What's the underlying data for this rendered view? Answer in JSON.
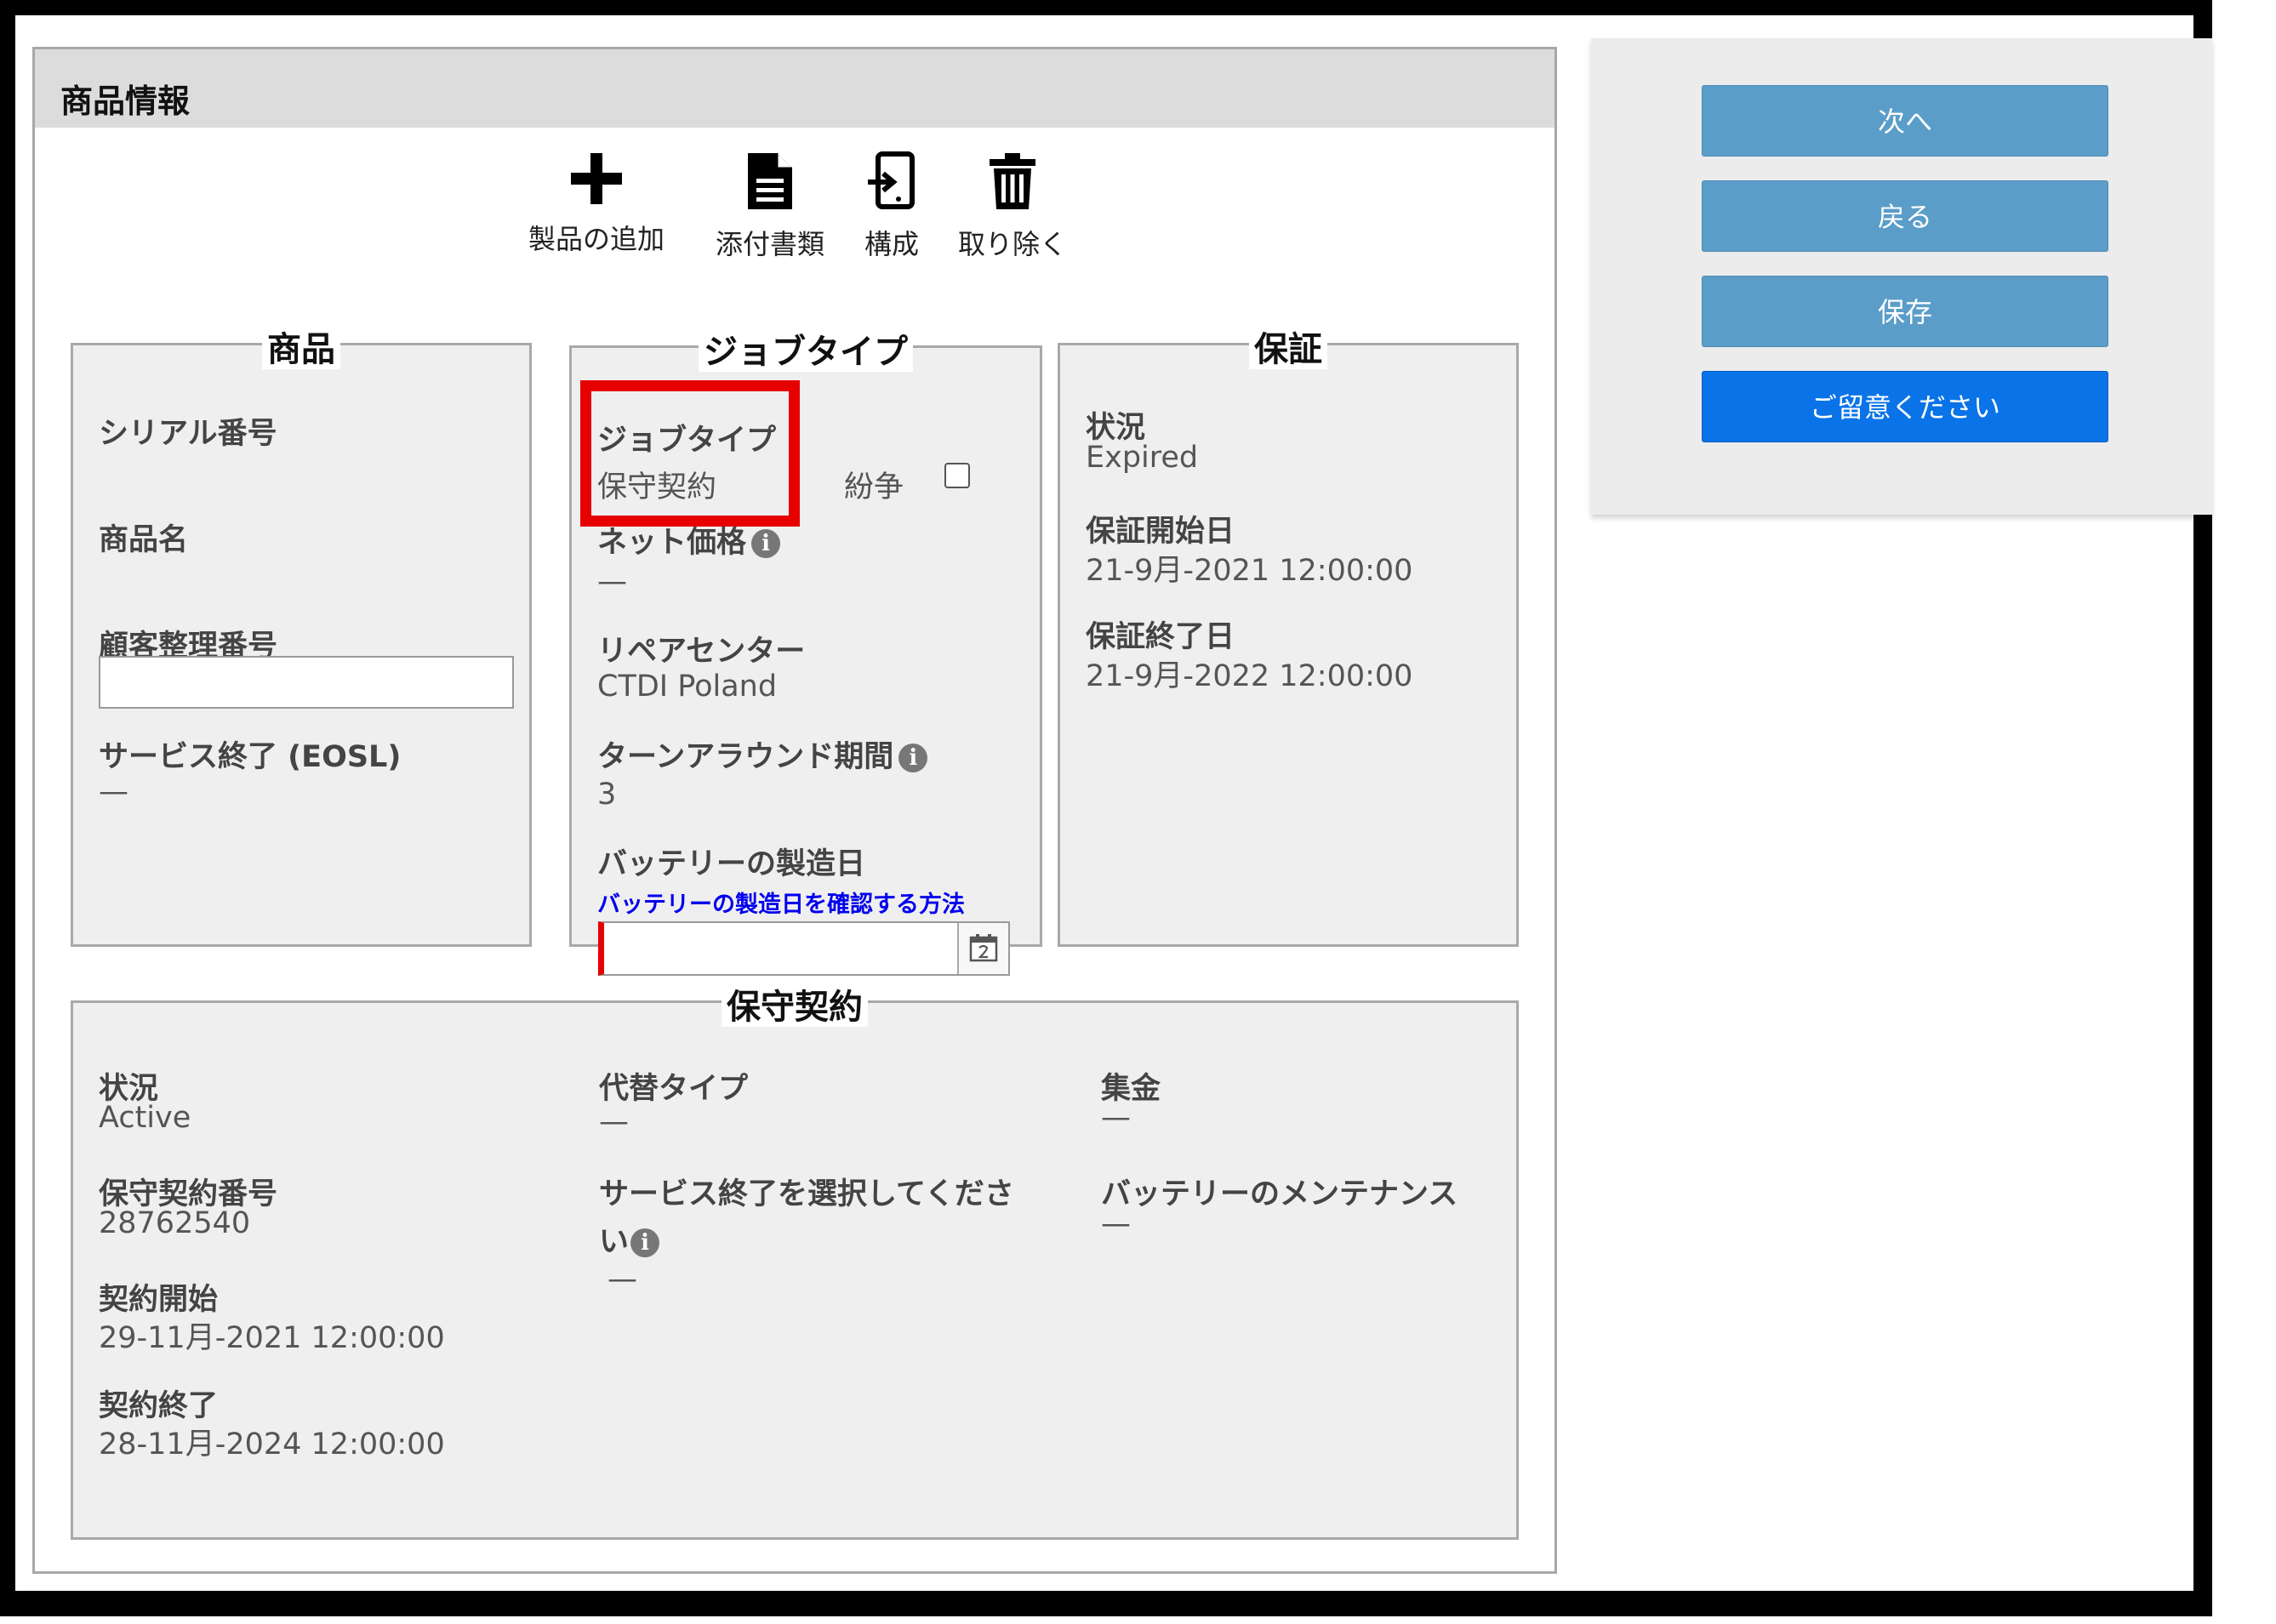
{
  "panel_title": "商品情報",
  "toolbar": [
    {
      "label": "製品の追加",
      "icon": "plus-icon"
    },
    {
      "label": "添付書類",
      "icon": "document-icon"
    },
    {
      "label": "構成",
      "icon": "configuration-icon"
    },
    {
      "label": "取り除く",
      "icon": "trash-icon"
    }
  ],
  "product": {
    "legend": "商品",
    "serial_label": "シリアル番号",
    "name_label": "商品名",
    "customer_ref_label": "顧客整理番号",
    "customer_ref_value": "",
    "eosl_label": "サービス終了 (EOSL)",
    "eosl_value": "—"
  },
  "job_type": {
    "legend": "ジョブタイプ",
    "type_label": "ジョブタイプ",
    "type_value": "保守契約",
    "dispute_label": "紛争",
    "dispute_checked": false,
    "net_price_label": "ネット価格",
    "net_price_value": "—",
    "repair_center_label": "リペアセンター",
    "repair_center_value": "CTDI Poland",
    "turnaround_label": "ターンアラウンド期間",
    "turnaround_value": "3",
    "battery_date_label": "バッテリーの製造日",
    "battery_date_link": "バッテリーの製造日を確認する方法",
    "battery_date_value": ""
  },
  "warranty": {
    "legend": "保証",
    "status_label": "状況",
    "status_value": "Expired",
    "start_label": "保証開始日",
    "start_value": "21-9月-2021 12:00:00",
    "end_label": "保証終了日",
    "end_value": "21-9月-2022 12:00:00"
  },
  "contract": {
    "legend": "保守契約",
    "status_label": "状況",
    "status_value": "Active",
    "number_label": "保守契約番号",
    "number_value": "28762540",
    "start_label": "契約開始",
    "start_value": "29-11月-2021 12:00:00",
    "end_label": "契約終了",
    "end_value": "28-11月-2024 12:00:00",
    "substitute_label": "代替タイプ",
    "substitute_value": "—",
    "eos_select_label_1": "サービス終了を選択してくださ",
    "eos_select_label_2": "い",
    "eos_select_value": "—",
    "collection_label": "集金",
    "collection_value": "—",
    "battery_maintenance_label": "バッテリーのメンテナンス",
    "battery_maintenance_value": "—"
  },
  "side_buttons": {
    "next": "次へ",
    "back": "戻る",
    "save": "保存",
    "attention": "ご留意ください"
  },
  "colors": {
    "highlight": "#e60000",
    "button_blue": "#5b9dc9",
    "button_primary": "#0a73e8",
    "link": "#0000ee"
  }
}
